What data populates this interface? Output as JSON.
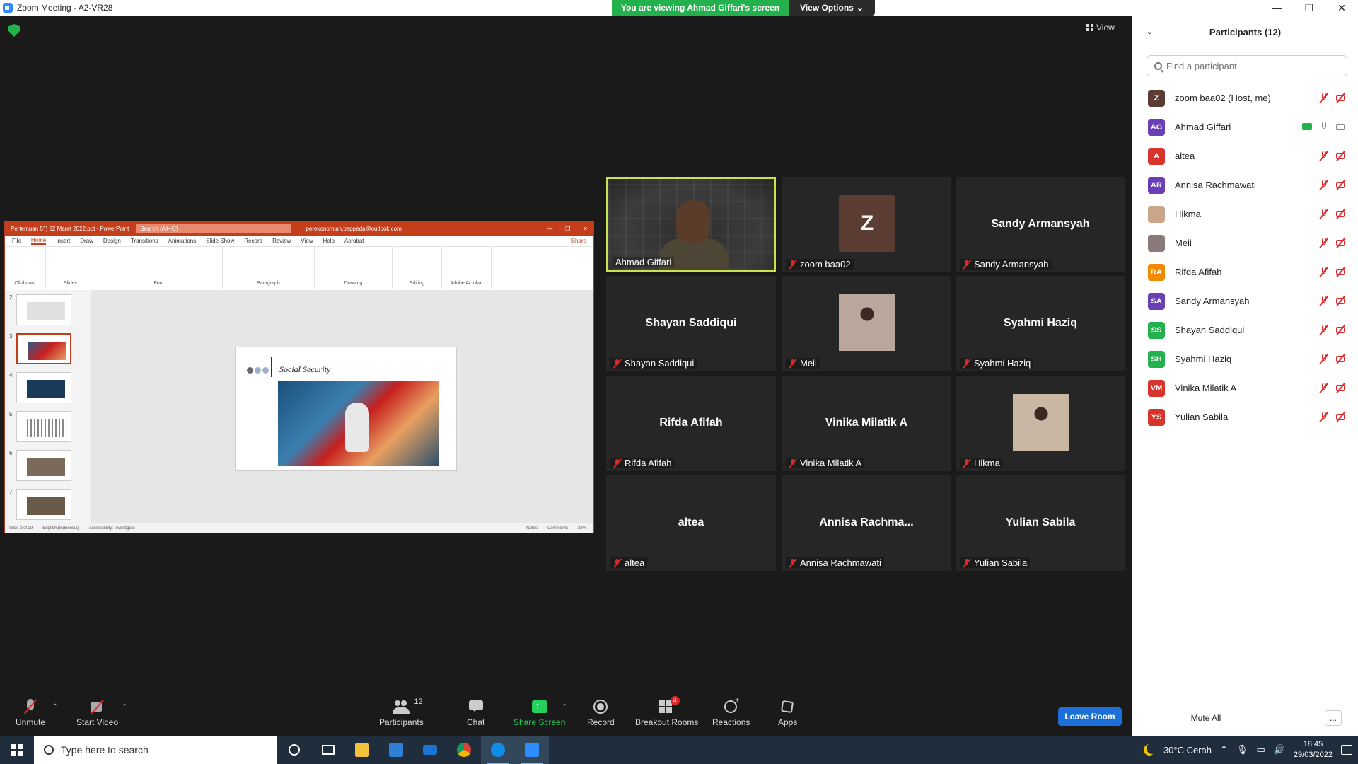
{
  "window": {
    "title": "Zoom Meeting - A2-VR28",
    "controls": [
      "—",
      "❐",
      "✕"
    ]
  },
  "banner": {
    "viewing_text": "You are viewing Ahmad Giffari's screen",
    "view_options_label": "View Options",
    "view_label": "View"
  },
  "shared_screen": {
    "ppt_title": "Pertemuan 5^) 22 Maret 2022.ppt - PowerPoint",
    "search_placeholder": "Search (Alt+Q)",
    "account_email": "perekonomian.bappeda@outlook.com",
    "tabs": [
      "File",
      "Home",
      "Insert",
      "Draw",
      "Design",
      "Transitions",
      "Animations",
      "Slide Show",
      "Record",
      "Review",
      "View",
      "Help",
      "Acrobat"
    ],
    "active_tab": "Home",
    "share_label": "Share",
    "ribbon_groups": [
      "Clipboard",
      "Slides",
      "Font",
      "Paragraph",
      "Drawing",
      "Editing",
      "Adobe Acrobat"
    ],
    "thumb_numbers": [
      "2",
      "3",
      "4",
      "5",
      "6",
      "7"
    ],
    "slide_title": "Social Security",
    "status_left": "Slide 3 of 29",
    "status_lang": "English (Indonesia)",
    "status_access": "Accessibility: Investigate",
    "status_notes": "Notes",
    "status_comments": "Comments",
    "zoom_level": "38%"
  },
  "tiles": [
    {
      "big": "",
      "name": "Ahmad Giffari",
      "type": "video",
      "muted": false,
      "speaking": true
    },
    {
      "big": "Z",
      "name": "zoom baa02",
      "type": "avatar",
      "avatar_color": "#5c3d33",
      "muted": true,
      "speaking": false
    },
    {
      "big": "Sandy Armansyah",
      "name": "Sandy Armansyah",
      "type": "text",
      "muted": true,
      "speaking": false
    },
    {
      "big": "Shayan Saddiqui",
      "name": "Shayan Saddiqui",
      "type": "text",
      "muted": true,
      "speaking": false
    },
    {
      "big": "",
      "name": "Meii",
      "type": "photo",
      "photo_color": "#b8a79a",
      "muted": true,
      "speaking": false
    },
    {
      "big": "Syahmi Haziq",
      "name": "Syahmi Haziq",
      "type": "text",
      "muted": true,
      "speaking": false
    },
    {
      "big": "Rifda Afifah",
      "name": "Rifda Afifah",
      "type": "text",
      "muted": true,
      "speaking": false
    },
    {
      "big": "Vinika Milatik A",
      "name": "Vinika Milatik A",
      "type": "text",
      "muted": true,
      "speaking": false
    },
    {
      "big": "",
      "name": "Hikma",
      "type": "photo",
      "photo_color": "#c9b6a3",
      "muted": true,
      "speaking": false
    },
    {
      "big": "altea",
      "name": "altea",
      "type": "text",
      "muted": true,
      "speaking": false
    },
    {
      "big": "Annisa  Rachma...",
      "name": "Annisa Rachmawati",
      "type": "text",
      "muted": true,
      "speaking": false
    },
    {
      "big": "Yulian Sabila",
      "name": "Yulian Sabila",
      "type": "text",
      "muted": true,
      "speaking": false
    }
  ],
  "toolbar": {
    "unmute": "Unmute",
    "start_video": "Start Video",
    "participants": "Participants",
    "participants_count": "12",
    "chat": "Chat",
    "share_screen": "Share Screen",
    "record": "Record",
    "breakout_rooms": "Breakout Rooms",
    "breakout_badge": "4",
    "reactions": "Reactions",
    "apps": "Apps",
    "leave_room": "Leave Room"
  },
  "panel": {
    "title": "Participants (12)",
    "search_placeholder": "Find a participant",
    "mute_all": "Mute All",
    "more": "...",
    "participants": [
      {
        "initials": "Z",
        "name": "zoom baa02 (Host, me)",
        "color": "#5c3d33",
        "mic": "off",
        "video": "off",
        "sharing": false
      },
      {
        "initials": "AG",
        "name": "Ahmad Giffari",
        "color": "#6a3fb5",
        "mic": "on",
        "video": "on",
        "sharing": true
      },
      {
        "initials": "A",
        "name": "altea",
        "color": "#d9342b",
        "mic": "off",
        "video": "off",
        "sharing": false
      },
      {
        "initials": "AR",
        "name": "Annisa Rachmawati",
        "color": "#6a3fb5",
        "mic": "off",
        "video": "off",
        "sharing": false
      },
      {
        "initials": "",
        "name": "Hikma",
        "color": "#c9a58a",
        "mic": "off",
        "video": "off",
        "sharing": false
      },
      {
        "initials": "",
        "name": "Meii",
        "color": "#8a7a7a",
        "mic": "off",
        "video": "off",
        "sharing": false
      },
      {
        "initials": "RA",
        "name": "Rifda Afifah",
        "color": "#f08a00",
        "mic": "off",
        "video": "off",
        "sharing": false
      },
      {
        "initials": "SA",
        "name": "Sandy Armansyah",
        "color": "#6a3fb5",
        "mic": "off",
        "video": "off",
        "sharing": false
      },
      {
        "initials": "SS",
        "name": "Shayan Saddiqui",
        "color": "#23b14d",
        "mic": "off",
        "video": "off",
        "sharing": false
      },
      {
        "initials": "SH",
        "name": "Syahmi Haziq",
        "color": "#23b14d",
        "mic": "off",
        "video": "off",
        "sharing": false
      },
      {
        "initials": "VM",
        "name": "Vinika Milatik A",
        "color": "#d9342b",
        "mic": "off",
        "video": "off",
        "sharing": false
      },
      {
        "initials": "YS",
        "name": "Yulian Sabila",
        "color": "#d9342b",
        "mic": "off",
        "video": "off",
        "sharing": false
      }
    ]
  },
  "taskbar": {
    "search_placeholder": "Type here to search",
    "weather": "30°C  Cerah",
    "time": "18:45",
    "date": "29/03/2022"
  }
}
